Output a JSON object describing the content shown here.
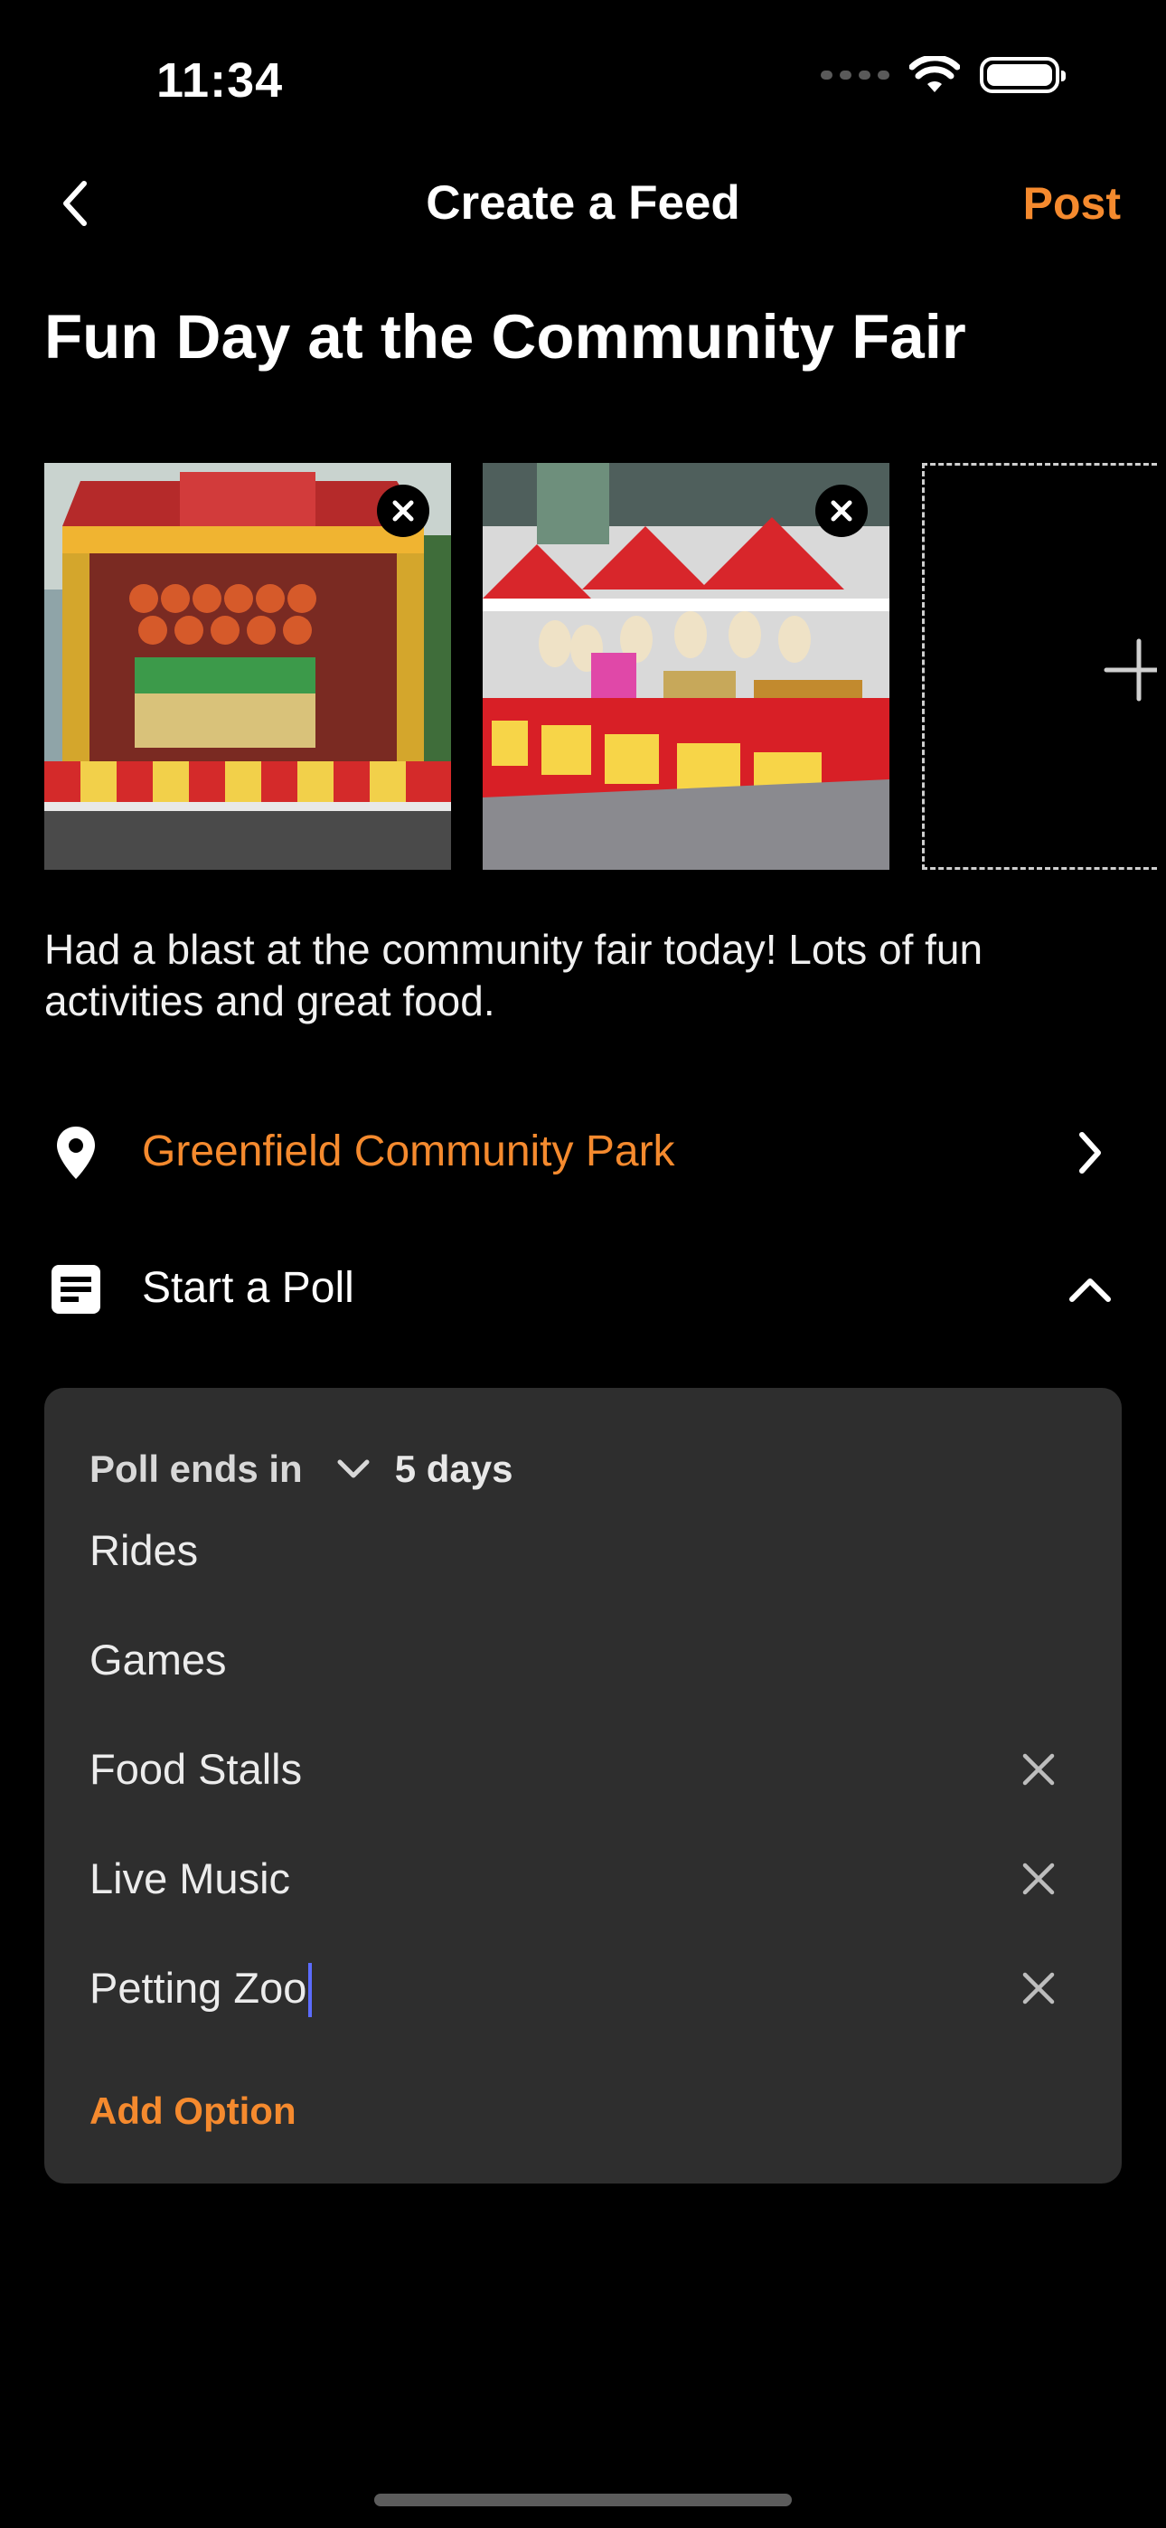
{
  "status_bar": {
    "time": "11:34"
  },
  "nav": {
    "title": "Create a Feed",
    "post_label": "Post"
  },
  "feed": {
    "title": "Fun Day at the Community Fair",
    "description": "Had a blast at the community fair today! Lots of fun activities and great food."
  },
  "photos": [
    {
      "name": "carnival-game-booth-photo"
    },
    {
      "name": "fair-stall-plushies-photo"
    }
  ],
  "location": {
    "label": "Greenfield Community Park"
  },
  "poll_toggle": {
    "label": "Start a Poll",
    "expanded": true
  },
  "poll": {
    "ends_label": "Poll ends in",
    "duration": "5 days",
    "options": [
      {
        "text": "Rides",
        "removable": false
      },
      {
        "text": "Games",
        "removable": false
      },
      {
        "text": "Food Stalls",
        "removable": true
      },
      {
        "text": "Live Music",
        "removable": true
      },
      {
        "text": "Petting Zoo",
        "removable": true,
        "focused": true
      }
    ],
    "add_option_label": "Add Option"
  },
  "colors": {
    "accent": "#f58a2e",
    "background": "#000000",
    "card": "#2e2e2e",
    "cursor": "#5b6cff"
  }
}
